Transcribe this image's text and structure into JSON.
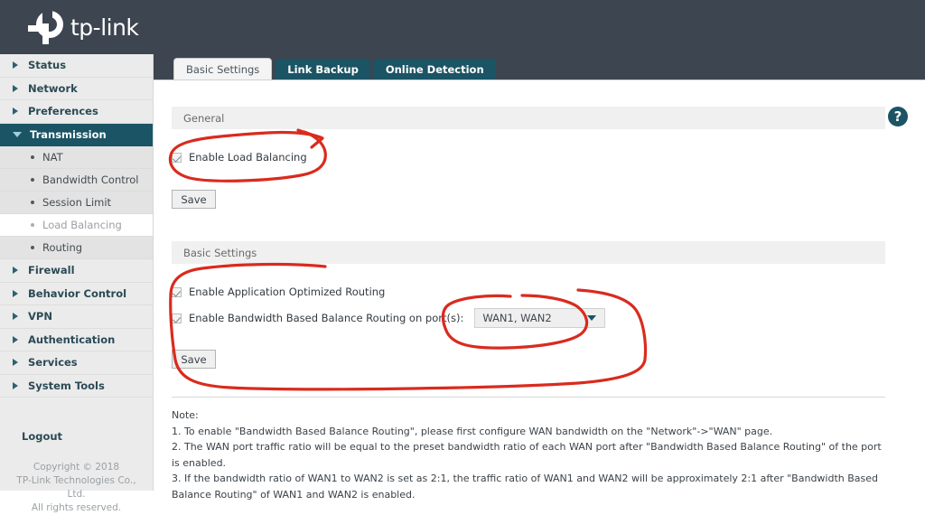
{
  "header": {
    "brand": "tp-link"
  },
  "sidebar": {
    "items": [
      {
        "label": "Status",
        "active": false
      },
      {
        "label": "Network",
        "active": false
      },
      {
        "label": "Preferences",
        "active": false
      },
      {
        "label": "Transmission",
        "active": true
      },
      {
        "label": "Firewall",
        "active": false
      },
      {
        "label": "Behavior Control",
        "active": false
      },
      {
        "label": "VPN",
        "active": false
      },
      {
        "label": "Authentication",
        "active": false
      },
      {
        "label": "Services",
        "active": false
      },
      {
        "label": "System Tools",
        "active": false
      }
    ],
    "sub_items": [
      {
        "label": "NAT",
        "selected": false
      },
      {
        "label": "Bandwidth Control",
        "selected": false
      },
      {
        "label": "Session Limit",
        "selected": false
      },
      {
        "label": "Load Balancing",
        "selected": true
      },
      {
        "label": "Routing",
        "selected": false
      }
    ],
    "logout_label": "Logout",
    "copyright_line1": "Copyright © 2018",
    "copyright_line2": "TP-Link Technologies Co., Ltd.",
    "copyright_line3": "All rights reserved."
  },
  "tabs": [
    {
      "label": "Basic Settings",
      "active": true
    },
    {
      "label": "Link Backup",
      "active": false
    },
    {
      "label": "Online Detection",
      "active": false
    }
  ],
  "help": {
    "glyph": "?"
  },
  "general": {
    "section_title": "General",
    "enable_load_balancing_label": "Enable Load Balancing",
    "enable_load_balancing_checked": true,
    "save_label": "Save"
  },
  "basic_settings": {
    "section_title": "Basic Settings",
    "app_optimized_label": "Enable Application Optimized Routing",
    "app_optimized_checked": true,
    "bandwidth_based_label": "Enable Bandwidth Based Balance Routing on port(s):",
    "bandwidth_based_checked": true,
    "ports_selected": "WAN1, WAN2",
    "save_label": "Save"
  },
  "note": {
    "title": "Note:",
    "lines": [
      "1. To enable \"Bandwidth Based Balance Routing\", please first configure WAN bandwidth on the \"Network\"->\"WAN\" page.",
      "2. The WAN port traffic ratio will be equal to the preset bandwidth ratio of each WAN port after \"Bandwidth Based Balance Routing\" of the port is enabled.",
      "3. If the bandwidth ratio of WAN1 to WAN2 is set as 2:1, the traffic ratio of WAN1 and WAN2 will be approximately 2:1 after \"Bandwidth Based Balance Routing\" of WAN1 and WAN2 is enabled."
    ]
  },
  "annotations": {
    "color": "#d92b1e",
    "shapes": [
      "ellipse-around-enable-load-balancing",
      "loop-around-basic-settings-block",
      "loop-around-wan-port-dropdown"
    ]
  }
}
